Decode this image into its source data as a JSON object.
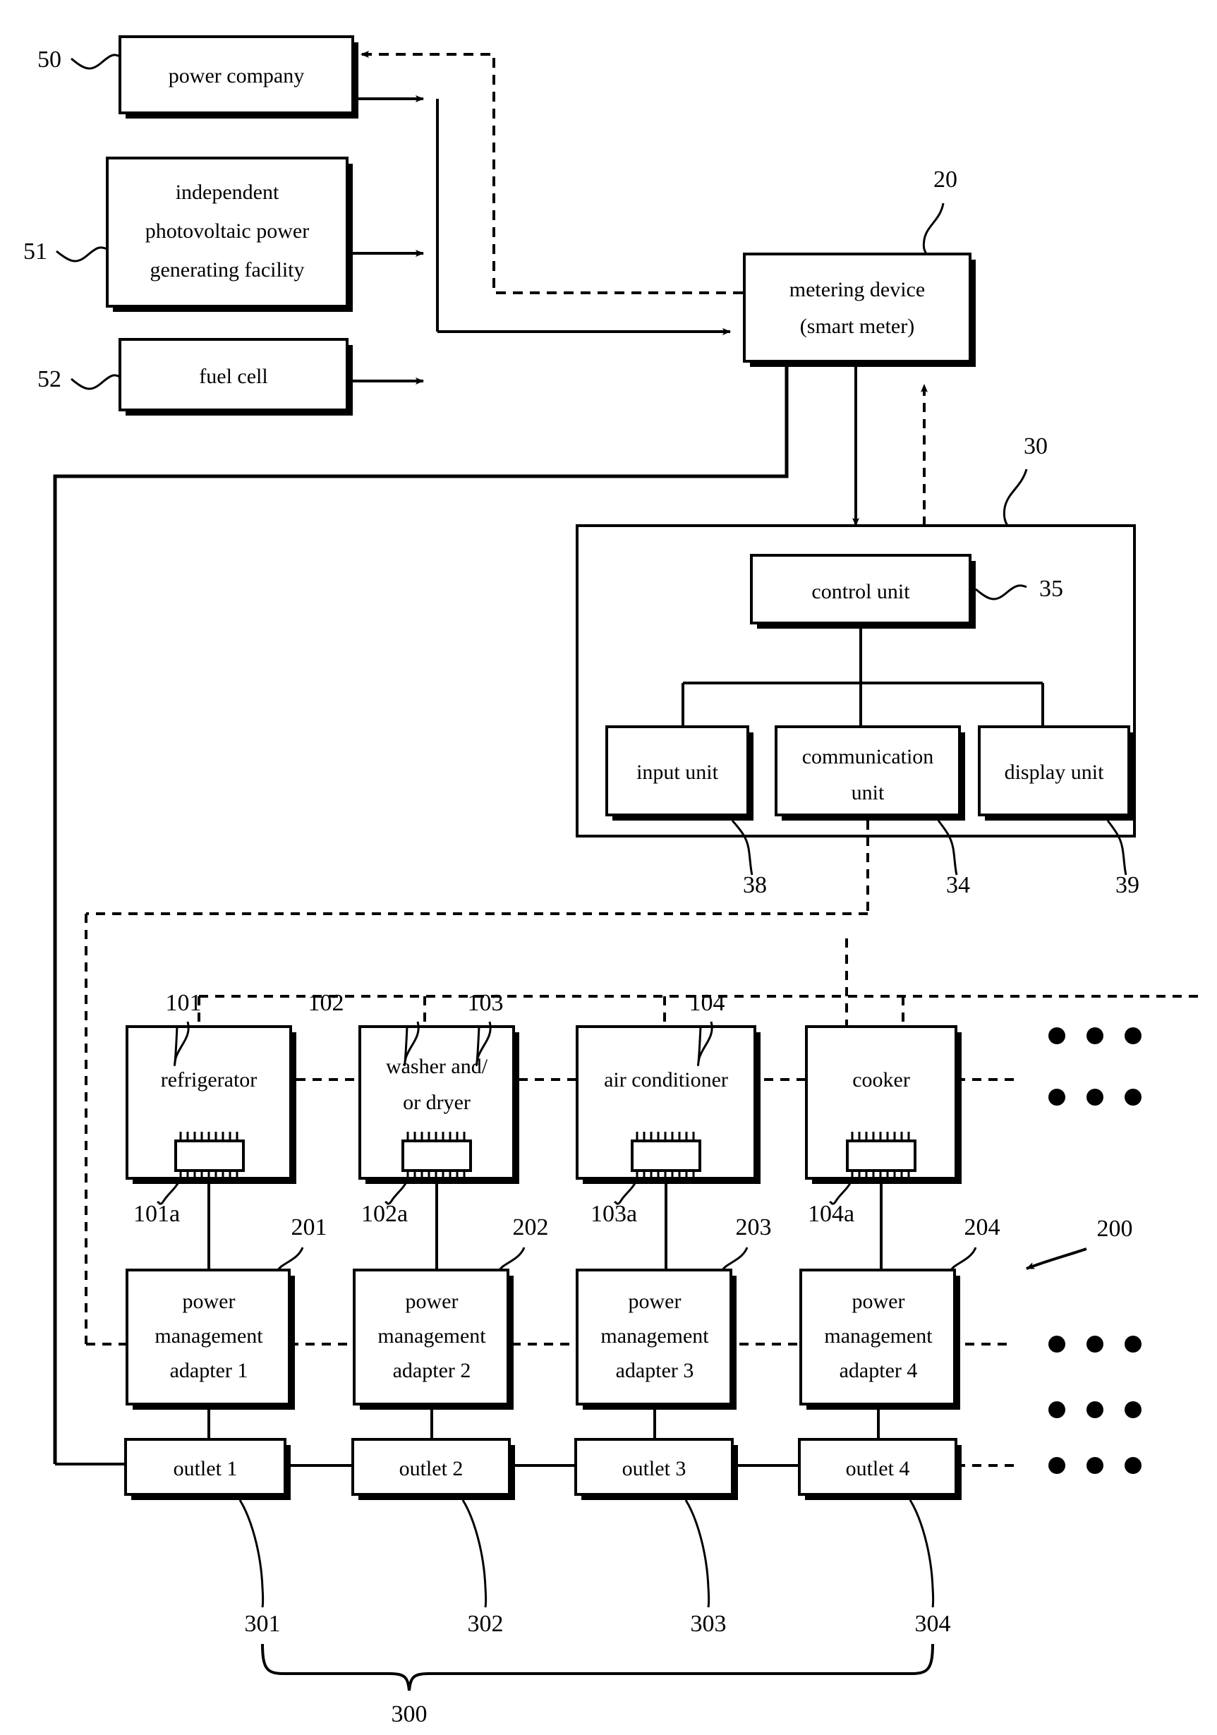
{
  "figure": {
    "type": "patent-block-diagram",
    "title": "",
    "line_color": "#000000",
    "background": "#ffffff"
  },
  "sources": {
    "power_company": {
      "label": "power company",
      "ref": "50"
    },
    "pv_facility": {
      "label_line1": "independent",
      "label_line2": "photovoltaic power",
      "label_line3": "generating facility",
      "ref": "51"
    },
    "fuel_cell": {
      "label": "fuel cell",
      "ref": "52"
    }
  },
  "meter": {
    "label_line1": "metering device",
    "label_line2": "(smart meter)",
    "ref": "20"
  },
  "controller": {
    "ref": "30",
    "control_unit": {
      "label": "control unit",
      "ref": "35"
    },
    "input_unit": {
      "label": "input unit",
      "ref": "38"
    },
    "communication_unit": {
      "label_line1": "communication",
      "label_line2": "unit",
      "ref": "34"
    },
    "display_unit": {
      "label": "display unit",
      "ref": "39"
    }
  },
  "appliances": [
    {
      "label_line1": "refrigerator",
      "label_line2": "",
      "ref": "101",
      "chip_ref": "101a"
    },
    {
      "label_line1": "washer and/",
      "label_line2": "or dryer",
      "ref": "102",
      "chip_ref": "102a"
    },
    {
      "label_line1": "air conditioner",
      "label_line2": "",
      "ref": "103",
      "chip_ref": "103a"
    },
    {
      "label_line1": "cooker",
      "label_line2": "",
      "ref": "104",
      "chip_ref": "104a"
    }
  ],
  "adapters": [
    {
      "label_line1": "power",
      "label_line2": "management",
      "label_line3": "adapter 1",
      "ref": "201"
    },
    {
      "label_line1": "power",
      "label_line2": "management",
      "label_line3": "adapter 2",
      "ref": "202"
    },
    {
      "label_line1": "power",
      "label_line2": "management",
      "label_line3": "adapter 3",
      "ref": "203"
    },
    {
      "label_line1": "power",
      "label_line2": "management",
      "label_line3": "adapter 4",
      "ref": "204"
    }
  ],
  "adapters_group_ref": "200",
  "outlets": [
    {
      "label": "outlet  1",
      "ref": "301"
    },
    {
      "label": "outlet  2",
      "ref": "302"
    },
    {
      "label": "outlet  3",
      "ref": "303"
    },
    {
      "label": "outlet  4",
      "ref": "304"
    }
  ],
  "outlets_group_ref": "300",
  "ellipsis": "• • •"
}
